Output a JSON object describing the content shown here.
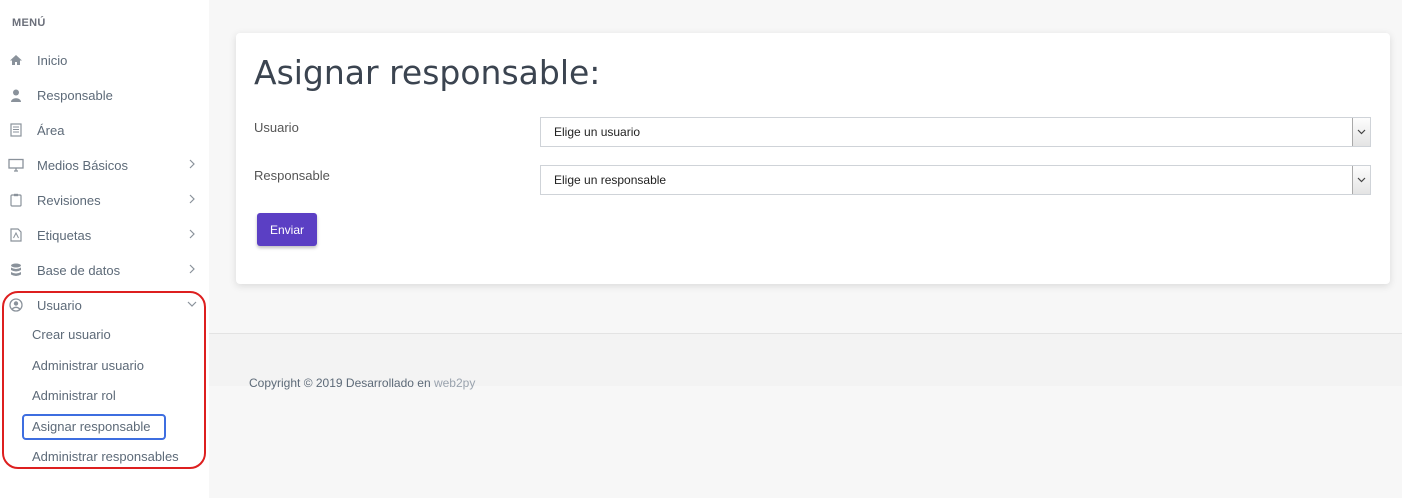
{
  "sidebar": {
    "title": "MENÚ",
    "items": [
      {
        "label": "Inicio",
        "icon": "home-icon"
      },
      {
        "label": "Responsable",
        "icon": "user-icon"
      },
      {
        "label": "Área",
        "icon": "building-icon"
      },
      {
        "label": "Medios Básicos",
        "icon": "monitor-icon"
      },
      {
        "label": "Revisiones",
        "icon": "clipboard-icon"
      },
      {
        "label": "Etiquetas",
        "icon": "pdf-file-icon"
      },
      {
        "label": "Base de datos",
        "icon": "database-icon"
      },
      {
        "label": "Usuario",
        "icon": "user-circle-icon"
      }
    ],
    "usuario_submenu": [
      {
        "label": "Crear usuario"
      },
      {
        "label": "Administrar usuario"
      },
      {
        "label": "Administrar rol"
      },
      {
        "label": "Asignar responsable"
      },
      {
        "label": "Administrar responsables"
      }
    ]
  },
  "form": {
    "title": "Asignar responsable:",
    "usuario_label": "Usuario",
    "usuario_selected": "Elige un usuario",
    "responsable_label": "Responsable",
    "responsable_selected": "Elige un responsable",
    "submit_label": "Enviar"
  },
  "footer": {
    "text": "Copyright © 2019 Desarrollado en ",
    "link": "web2py"
  },
  "colors": {
    "accent": "#5b3fc4",
    "highlight_outline": "#dd1f1f",
    "active_outline": "#3e6ee0"
  }
}
